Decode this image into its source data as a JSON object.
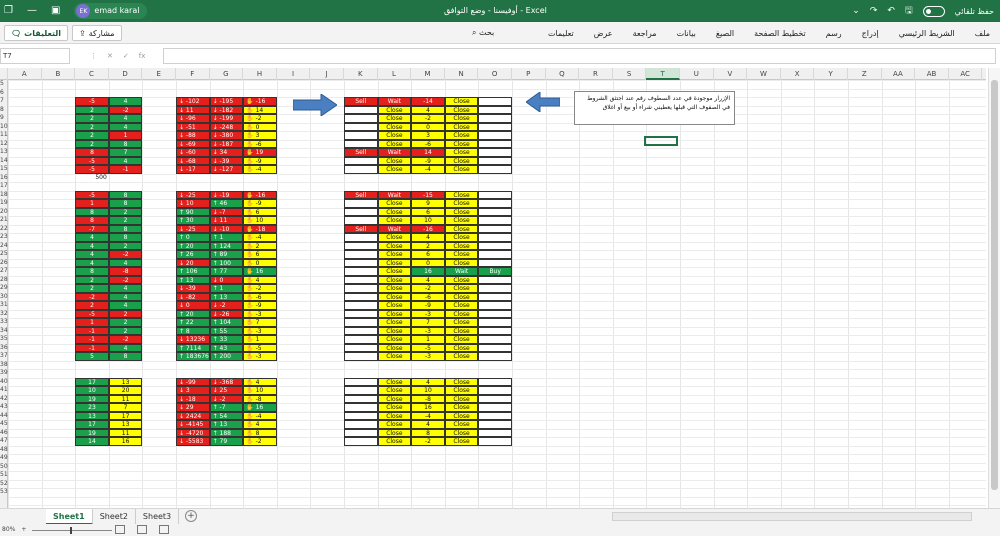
{
  "titlebar": {
    "user_initials": "EK",
    "user_name": "emad karal",
    "doc_title": "أوفيسنا  -  وضع التوافق  -  Excel",
    "autosave_label": "حفظ تلقائي"
  },
  "ribbon": {
    "comments_label": "التعليقات",
    "share_label": "مشاركة",
    "search_label": "بحث",
    "menu": [
      "ملف",
      "الشريط الرئيسي",
      "إدراج",
      "رسم",
      "تخطيط الصفحة",
      "الصيغ",
      "بيانات",
      "مراجعة",
      "عرض",
      "تعليمات"
    ]
  },
  "formula_bar": {
    "name_box": "T7",
    "fx": "fx",
    "value": ""
  },
  "columns": [
    "A",
    "B",
    "C",
    "D",
    "E",
    "F",
    "G",
    "H",
    "I",
    "J",
    "K",
    "L",
    "M",
    "N",
    "O",
    "P",
    "Q",
    "R",
    "S",
    "T",
    "U",
    "V",
    "W",
    "X",
    "Y",
    "Z",
    "AA",
    "AB",
    "AC"
  ],
  "selected_column": "T",
  "rows": [
    "5",
    "6",
    "7",
    "8",
    "9",
    "10",
    "11",
    "12",
    "13",
    "14",
    "15",
    "16",
    "17",
    "18",
    "19",
    "20",
    "21",
    "22",
    "23",
    "24",
    "25",
    "26",
    "27",
    "28",
    "29",
    "30",
    "31",
    "32",
    "33",
    "34",
    "35",
    "36",
    "37",
    "38",
    "39",
    "40",
    "41",
    "42",
    "43",
    "44",
    "45",
    "46",
    "47",
    "48",
    "49",
    "50",
    "51",
    "52",
    "53"
  ],
  "comment_text": "الإزرار موجودة في عدد السطوف رقم عند اجتثق الشروط في الصفوف التي قبلها يعطيني شراء أو بيع أو اغلاق",
  "label_500": "500",
  "block1_cd": [
    [
      "-5",
      "4",
      "r",
      "g"
    ],
    [
      "2",
      "-2",
      "g",
      "r"
    ],
    [
      "2",
      "4",
      "g",
      "g"
    ],
    [
      "2",
      "4",
      "g",
      "g"
    ],
    [
      "2",
      "1",
      "g",
      "r"
    ],
    [
      "2",
      "8",
      "g",
      "g"
    ],
    [
      "8",
      "7",
      "r",
      "g"
    ],
    [
      "-5",
      "4",
      "r",
      "g"
    ],
    [
      "-5",
      "-1",
      "r",
      "r"
    ]
  ],
  "block1_fgh": [
    [
      "-102",
      "-195",
      "-16",
      "r",
      "r",
      "r"
    ],
    [
      "11",
      "-182",
      "14",
      "r",
      "r",
      "y"
    ],
    [
      "-96",
      "-199",
      "-2",
      "r",
      "r",
      "y"
    ],
    [
      "-51",
      "-248",
      "0",
      "r",
      "r",
      "y"
    ],
    [
      "-88",
      "-380",
      "3",
      "r",
      "r",
      "y"
    ],
    [
      "-69",
      "-187",
      "-6",
      "r",
      "r",
      "y"
    ],
    [
      "-60",
      "34",
      "19",
      "r",
      "r",
      "r"
    ],
    [
      "-68",
      "-39",
      "-9",
      "r",
      "r",
      "y"
    ],
    [
      "-17",
      "-127",
      "-4",
      "r",
      "r",
      "y"
    ]
  ],
  "block1_kn": [
    [
      "Sell",
      "Wait",
      "-14",
      "Close"
    ],
    [
      "",
      "Close",
      "4",
      "Close"
    ],
    [
      "",
      "Close",
      "-2",
      "Close"
    ],
    [
      "",
      "Close",
      "0",
      "Close"
    ],
    [
      "",
      "Close",
      "3",
      "Close"
    ],
    [
      "",
      "Close",
      "-6",
      "Close"
    ],
    [
      "Sell",
      "Wait",
      "14",
      "Close"
    ],
    [
      "",
      "Close",
      "-9",
      "Close"
    ],
    [
      "",
      "Close",
      "-4",
      "Close"
    ]
  ],
  "block2_cd": [
    [
      "-5",
      "8",
      "r",
      "g"
    ],
    [
      "1",
      "8",
      "r",
      "g"
    ],
    [
      "8",
      "2",
      "g",
      "g"
    ],
    [
      "8",
      "2",
      "r",
      "g"
    ],
    [
      "-7",
      "8",
      "r",
      "g"
    ],
    [
      "4",
      "8",
      "g",
      "g"
    ],
    [
      "4",
      "2",
      "g",
      "g"
    ],
    [
      "4",
      "-2",
      "g",
      "r"
    ],
    [
      "4",
      "4",
      "g",
      "g"
    ],
    [
      "8",
      "-8",
      "g",
      "r"
    ],
    [
      "2",
      "-2",
      "g",
      "r"
    ],
    [
      "2",
      "4",
      "g",
      "g"
    ],
    [
      "-2",
      "4",
      "r",
      "g"
    ],
    [
      "2",
      "4",
      "r",
      "g"
    ],
    [
      "-5",
      "2",
      "r",
      "r"
    ],
    [
      "1",
      "2",
      "r",
      "g"
    ],
    [
      "-1",
      "2",
      "r",
      "g"
    ],
    [
      "-1",
      "-2",
      "r",
      "r"
    ],
    [
      "-1",
      "4",
      "r",
      "g"
    ],
    [
      "5",
      "8",
      "g",
      "g"
    ]
  ],
  "block2_fgh": [
    [
      "-25",
      "-19",
      "-16",
      "r",
      "r",
      "r"
    ],
    [
      "10",
      "46",
      "-9",
      "r",
      "g",
      "y"
    ],
    [
      "90",
      "-7",
      "6",
      "g",
      "r",
      "y"
    ],
    [
      "30",
      "11",
      "10",
      "g",
      "r",
      "y"
    ],
    [
      "-25",
      "-10",
      "-18",
      "r",
      "r",
      "r"
    ],
    [
      "0",
      "1",
      "-4",
      "g",
      "g",
      "y"
    ],
    [
      "20",
      "124",
      "2",
      "g",
      "g",
      "y"
    ],
    [
      "26",
      "89",
      "6",
      "g",
      "g",
      "y"
    ],
    [
      "20",
      "100",
      "0",
      "r",
      "g",
      "y"
    ],
    [
      "106",
      "77",
      "16",
      "g",
      "g",
      "g"
    ],
    [
      "13",
      "0",
      "4",
      "g",
      "r",
      "y"
    ],
    [
      "-39",
      "1",
      "-2",
      "r",
      "g",
      "y"
    ],
    [
      "-82",
      "13",
      "-6",
      "r",
      "g",
      "y"
    ],
    [
      "0",
      "-2",
      "-9",
      "r",
      "r",
      "y"
    ],
    [
      "20",
      "-26",
      "-3",
      "g",
      "r",
      "y"
    ],
    [
      "22",
      "104",
      "7",
      "g",
      "g",
      "y"
    ],
    [
      "8",
      "55",
      "-3",
      "g",
      "g",
      "y"
    ],
    [
      "13236",
      "33",
      "1",
      "r",
      "g",
      "y"
    ],
    [
      "7114",
      "43",
      "-5",
      "g",
      "g",
      "y"
    ],
    [
      "183676",
      "200",
      "-3",
      "g",
      "g",
      "y"
    ]
  ],
  "block2_kn": [
    [
      "Sell",
      "Wait",
      "-15",
      "Close"
    ],
    [
      "",
      "Close",
      "9",
      "Close"
    ],
    [
      "",
      "Close",
      "6",
      "Close"
    ],
    [
      "",
      "Close",
      "10",
      "Close"
    ],
    [
      "Sell",
      "Wait",
      "-16",
      "Close"
    ],
    [
      "",
      "Close",
      "4",
      "Close"
    ],
    [
      "",
      "Close",
      "2",
      "Close"
    ],
    [
      "",
      "Close",
      "6",
      "Close"
    ],
    [
      "",
      "Close",
      "0",
      "Close"
    ],
    [
      "",
      "Close",
      "16",
      "Wait",
      "Buy"
    ],
    [
      "",
      "Close",
      "4",
      "Close"
    ],
    [
      "",
      "Close",
      "-2",
      "Close"
    ],
    [
      "",
      "Close",
      "-6",
      "Close"
    ],
    [
      "",
      "Close",
      "-9",
      "Close"
    ],
    [
      "",
      "Close",
      "-3",
      "Close"
    ],
    [
      "",
      "Close",
      "7",
      "Close"
    ],
    [
      "",
      "Close",
      "-3",
      "Close"
    ],
    [
      "",
      "Close",
      "1",
      "Close"
    ],
    [
      "",
      "Close",
      "-5",
      "Close"
    ],
    [
      "",
      "Close",
      "-3",
      "Close"
    ]
  ],
  "block3_cd": [
    [
      "17",
      "13"
    ],
    [
      "10",
      "20"
    ],
    [
      "19",
      "11"
    ],
    [
      "23",
      "7"
    ],
    [
      "13",
      "17"
    ],
    [
      "17",
      "13"
    ],
    [
      "19",
      "11"
    ],
    [
      "14",
      "16"
    ]
  ],
  "block3_fgh": [
    [
      "-99",
      "-368",
      "4",
      "r",
      "r",
      "y"
    ],
    [
      "3",
      "25",
      "10",
      "r",
      "r",
      "y"
    ],
    [
      "-18",
      "-2",
      "-8",
      "r",
      "r",
      "y"
    ],
    [
      "29",
      "-7",
      "16",
      "r",
      "g",
      "g"
    ],
    [
      "2424",
      "54",
      "-4",
      "r",
      "g",
      "y"
    ],
    [
      "-4145",
      "13",
      "4",
      "r",
      "g",
      "y"
    ],
    [
      "-4720",
      "188",
      "8",
      "r",
      "g",
      "y"
    ],
    [
      "-5583",
      "79",
      "-2",
      "r",
      "g",
      "y"
    ]
  ],
  "block3_kn": [
    [
      "",
      "Close",
      "4",
      "Close"
    ],
    [
      "",
      "Close",
      "10",
      "Close"
    ],
    [
      "",
      "Close",
      "-8",
      "Close"
    ],
    [
      "",
      "Close",
      "16",
      "Close"
    ],
    [
      "",
      "Close",
      "-4",
      "Close"
    ],
    [
      "",
      "Close",
      "4",
      "Close"
    ],
    [
      "",
      "Close",
      "8",
      "Close"
    ],
    [
      "",
      "Close",
      "-2",
      "Close"
    ]
  ],
  "sheets": [
    "Sheet1",
    "Sheet2",
    "Sheet3"
  ],
  "active_sheet": "Sheet1",
  "zoom_label": "80%"
}
